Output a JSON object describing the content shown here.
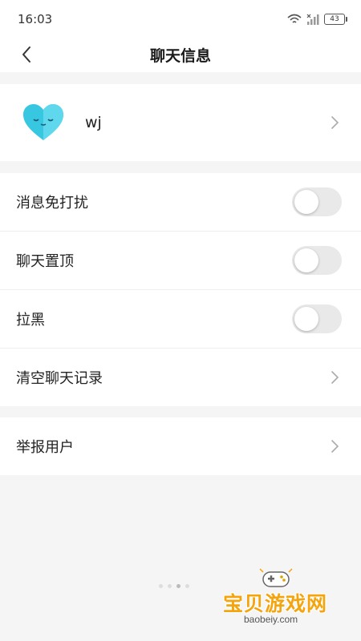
{
  "status_bar": {
    "time": "16:03",
    "battery": "43"
  },
  "nav": {
    "title": "聊天信息"
  },
  "profile": {
    "name": "wj"
  },
  "settings": [
    {
      "label": "消息免打扰",
      "control": "toggle",
      "on": false
    },
    {
      "label": "聊天置顶",
      "control": "toggle",
      "on": false
    },
    {
      "label": "拉黑",
      "control": "toggle",
      "on": false
    },
    {
      "label": "清空聊天记录",
      "control": "chevron"
    }
  ],
  "report": {
    "label": "举报用户"
  },
  "watermark": {
    "title": "宝贝游戏网",
    "url": "baobeiy.com"
  },
  "colors": {
    "background": "#f5f5f5",
    "toggle_off": "#e9e9e9",
    "watermark": "#f4a40d",
    "avatar_heart": "#38c7e0"
  }
}
